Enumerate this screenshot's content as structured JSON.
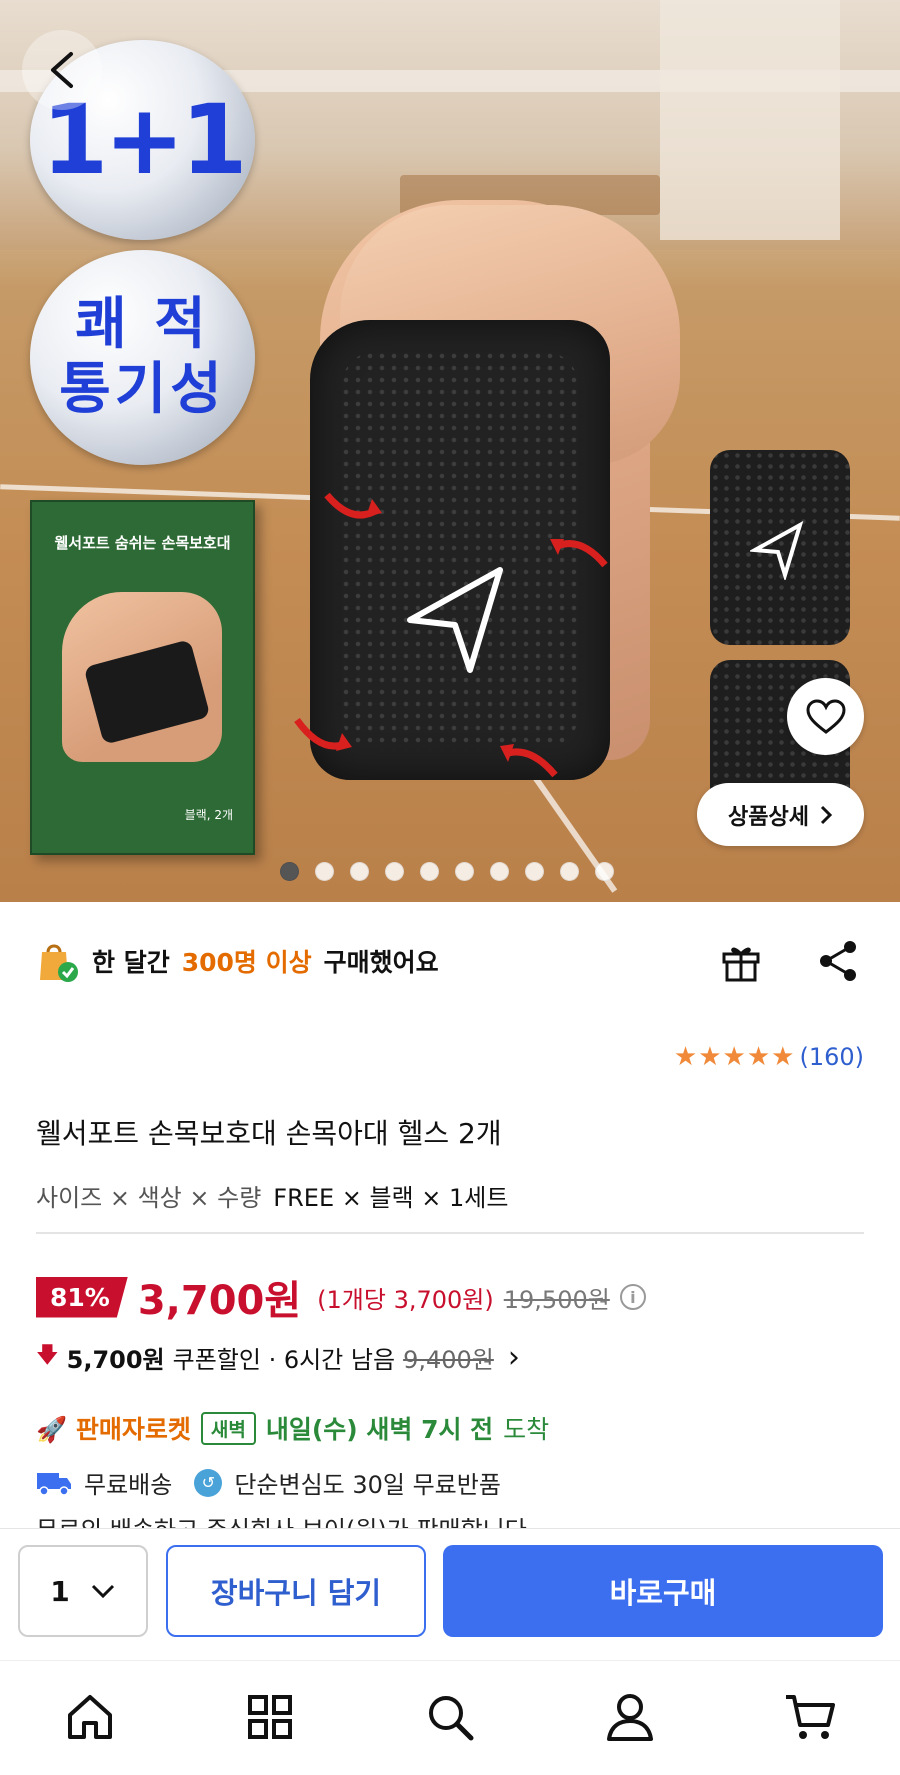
{
  "hero": {
    "badge_1": "1+1",
    "badge_2_line1": "쾌 적",
    "badge_2_line2": "통기성",
    "box_title": "웰서포트 숨쉬는 손목보호대",
    "box_sub": "블랙, 2개",
    "detail_button": "상품상세",
    "slide_count": 10,
    "active_slide": 0
  },
  "info": {
    "buyers_prefix": "한 달간",
    "buyers_highlight": "300명 이상",
    "buyers_suffix": "구매했어요",
    "stars": "★★★★★",
    "review_count": "(160)",
    "title": "웰서포트 손목보호대 손목아대 헬스 2개",
    "options_label": "사이즈 × 색상 × 수량",
    "options_value": "FREE × 블랙 × 1세트"
  },
  "price": {
    "discount": "81%",
    "price": "3,700원",
    "per_unit": "(1개당 3,700원)",
    "original": "19,500원",
    "info_icon": "i"
  },
  "coupon": {
    "arrow": "🡇",
    "amount": "5,700원",
    "label": "쿠폰할인 · 6시간 남음",
    "original": "9,400원",
    "chevron": "›"
  },
  "delivery": {
    "rocket": "🚀 판매자로켓",
    "tag": "새벽",
    "eta_bold": "내일(수) 새벽 7시 전",
    "eta_suffix": "도착",
    "free_shipping": "무료배송",
    "return_icon": "↺",
    "returns": "단순변심도 30일 무료반품",
    "partial_line": "무료의 배송하고 주식회사 보이(원)가 판매합니다"
  },
  "buybar": {
    "qty": "1",
    "cart": "장바구니 담기",
    "buy": "바로구매"
  },
  "colors": {
    "accent_blue": "#3b6ff0",
    "price_red": "#c8102e",
    "orange": "#e36b00",
    "green": "#2a8a3a"
  }
}
